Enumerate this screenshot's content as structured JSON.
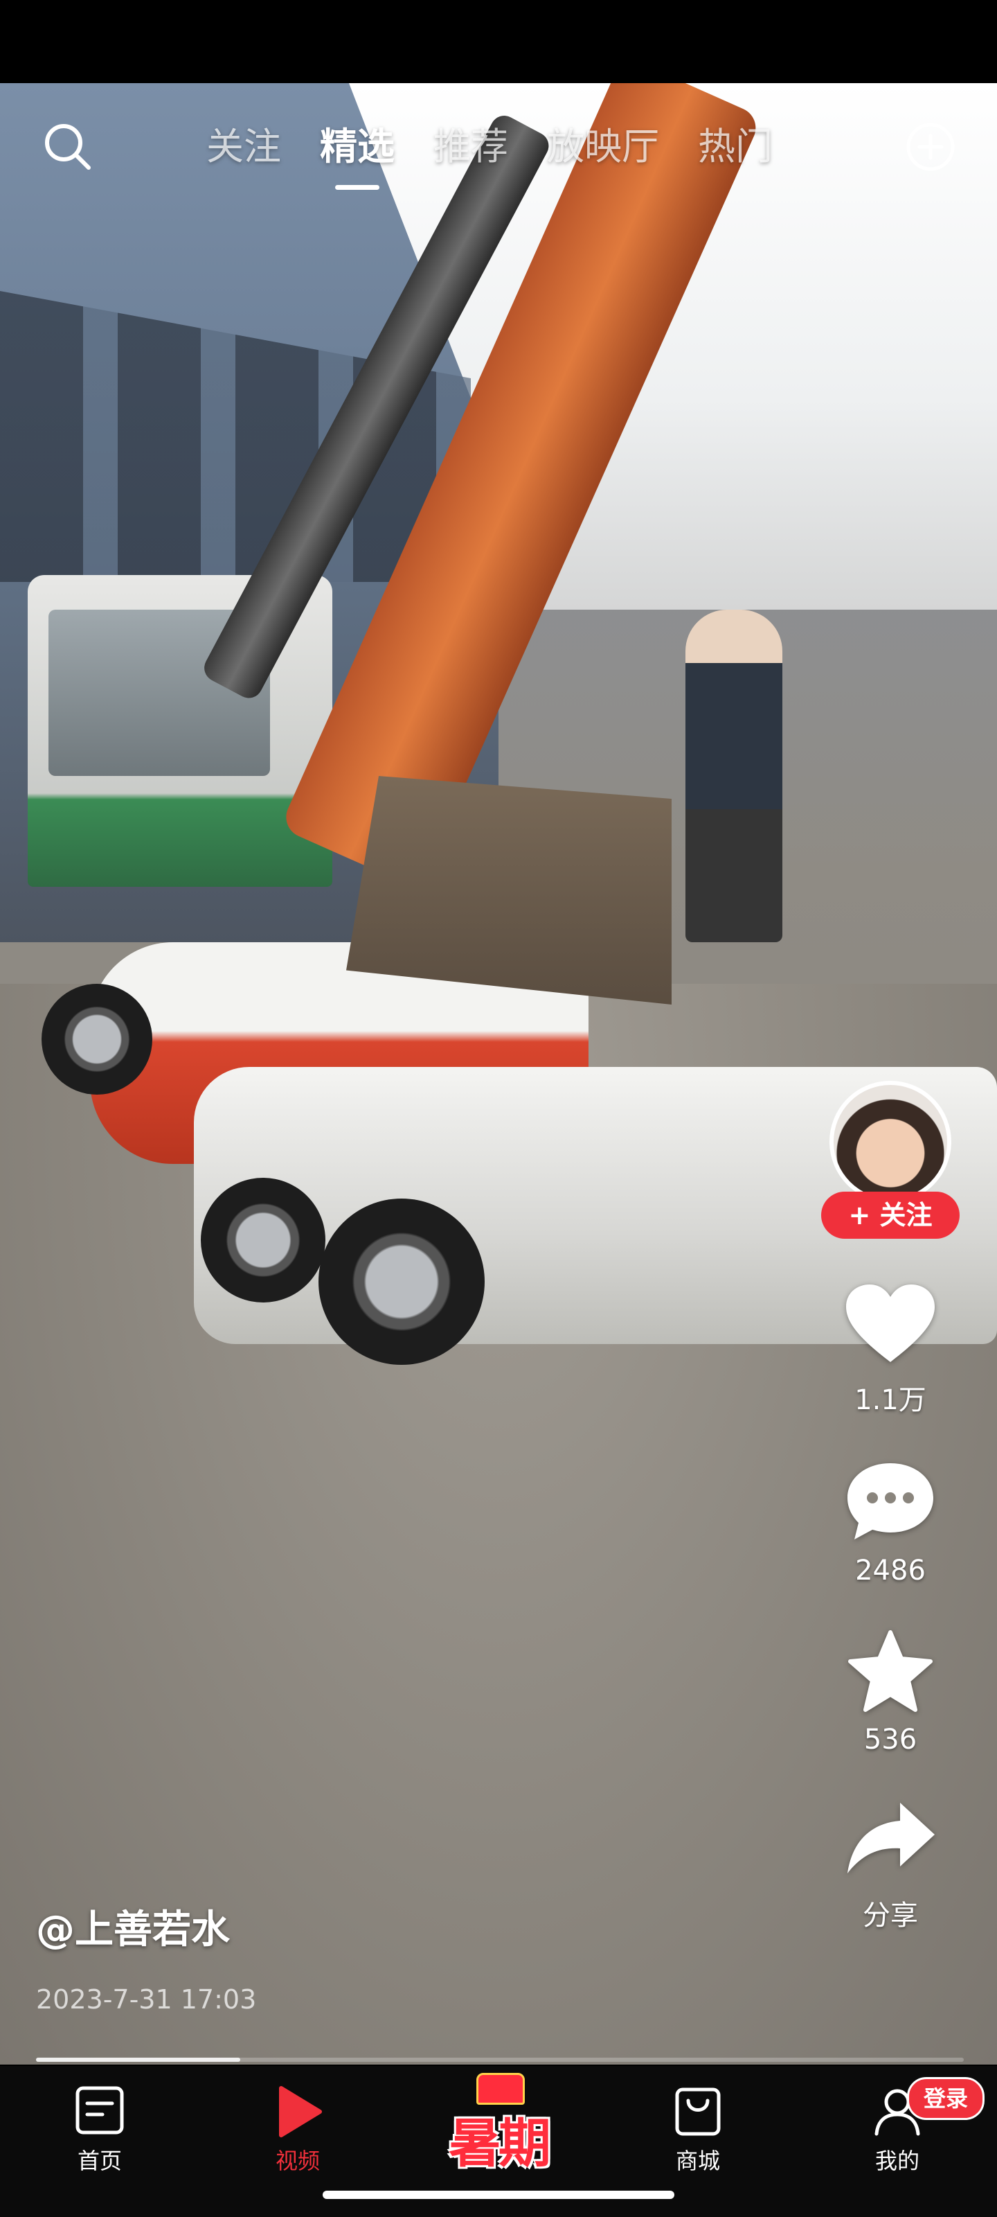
{
  "top_tabs": {
    "items": [
      {
        "label": "关注"
      },
      {
        "label": "精选"
      },
      {
        "label": "推荐"
      },
      {
        "label": "放映厅"
      },
      {
        "label": "热门"
      }
    ],
    "active_index": 1
  },
  "icons": {
    "search": "search-icon",
    "add": "plus-circle-icon",
    "like": "heart-icon",
    "comment": "comment-bubble-icon",
    "favorite": "star-icon",
    "share": "share-arrow-icon"
  },
  "creator": {
    "follow_label": "+ 关注"
  },
  "actions": {
    "like_count": "1.1万",
    "comment_count": "2486",
    "favorite_count": "536",
    "share_label": "分享"
  },
  "caption": {
    "author": "@上善若水",
    "timestamp": "2023-7-31 17:03"
  },
  "playback": {
    "progress_fraction": 0.22
  },
  "bottom_nav": {
    "home": "首页",
    "video": "视频",
    "promo": "暑期",
    "mall": "商城",
    "me": "我的",
    "login_badge": "登录"
  },
  "colors": {
    "accent": "#f0303b",
    "nav_bg": "#0b0b0b"
  }
}
